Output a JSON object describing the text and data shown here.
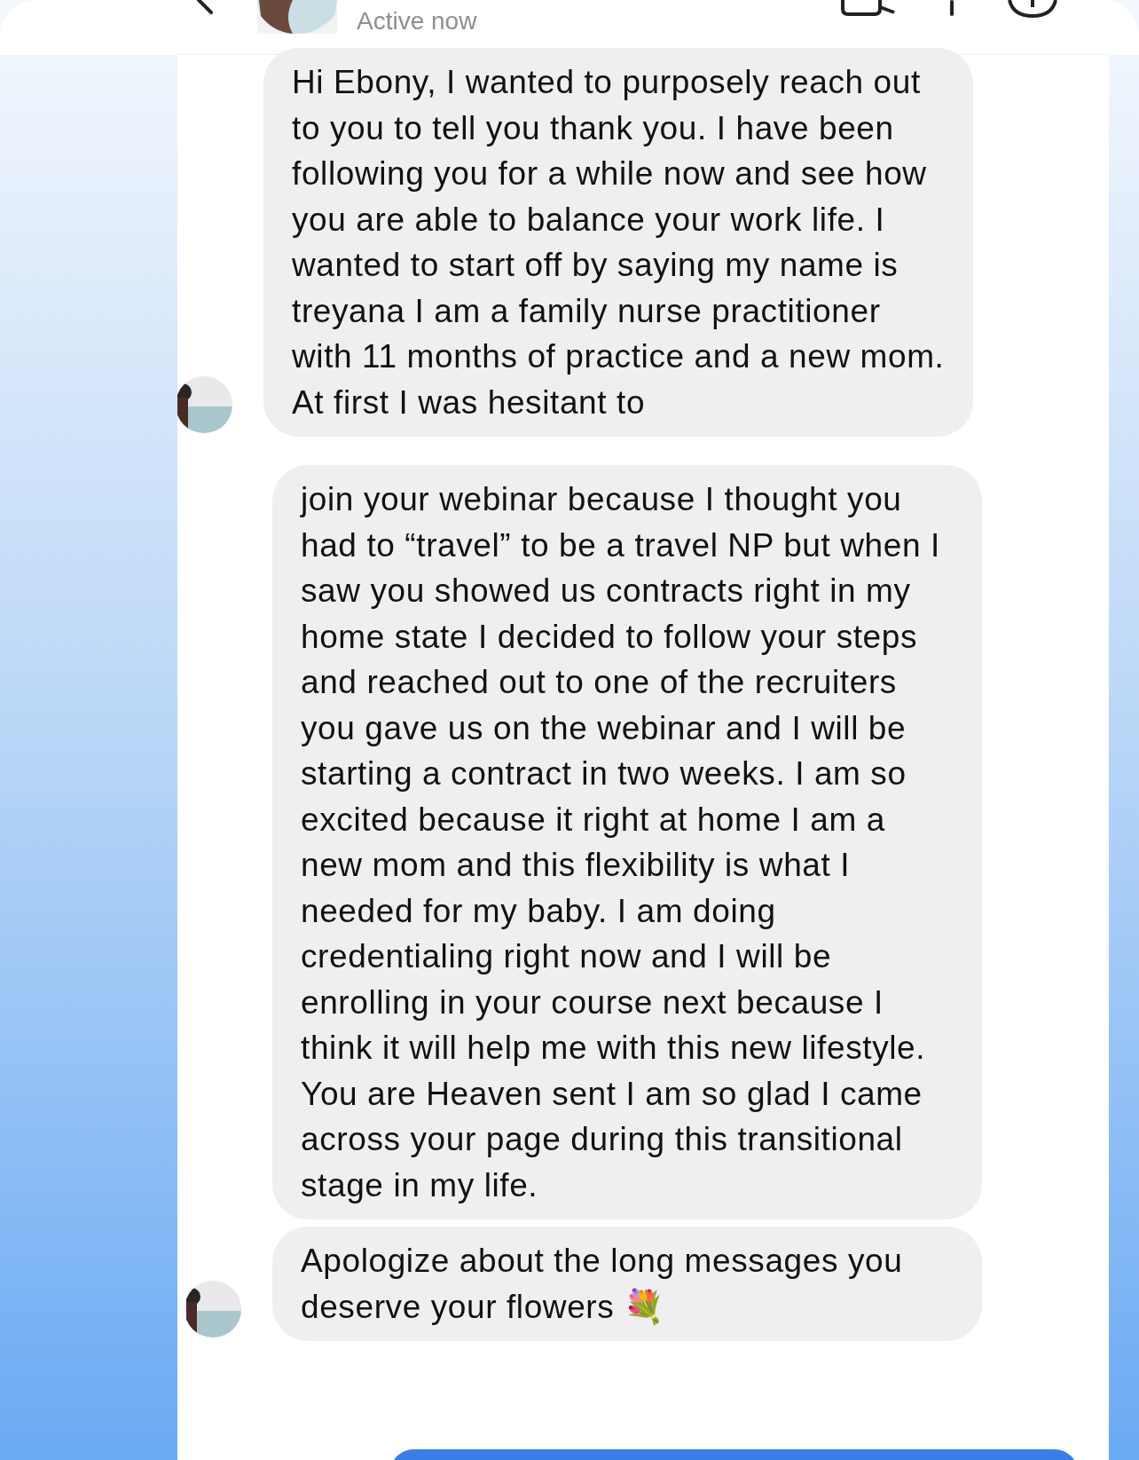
{
  "header": {
    "status": "Active now"
  },
  "messages": [
    {
      "text": "Hi Ebony, I wanted to purposely reach out to you to tell you thank you. I have been following you for a while now and see how you are able to balance your work life. I wanted to start off by saying my name is treyana I am a family nurse practitioner with 11 months of practice and a new mom. At first I was hesitant to",
      "avatar": true
    },
    {
      "text": "join your webinar because I thought you had to “travel” to be a travel NP but when I saw you showed us contracts right in my home state I decided to follow your steps and reached out to one of the recruiters you gave us on the webinar and I will be starting a contract in two weeks. I am so excited because it right at home I am a new mom and this flexibility is what I needed for my baby. I am doing credentialing right now and I will be enrolling in your course next because I think it will help me with this new lifestyle. You are Heaven sent I am so glad I came across your page during this transitional stage in my life.",
      "avatar": false
    },
    {
      "text": "Apologize about the long messages you deserve your flowers 💐",
      "avatar": true
    }
  ]
}
